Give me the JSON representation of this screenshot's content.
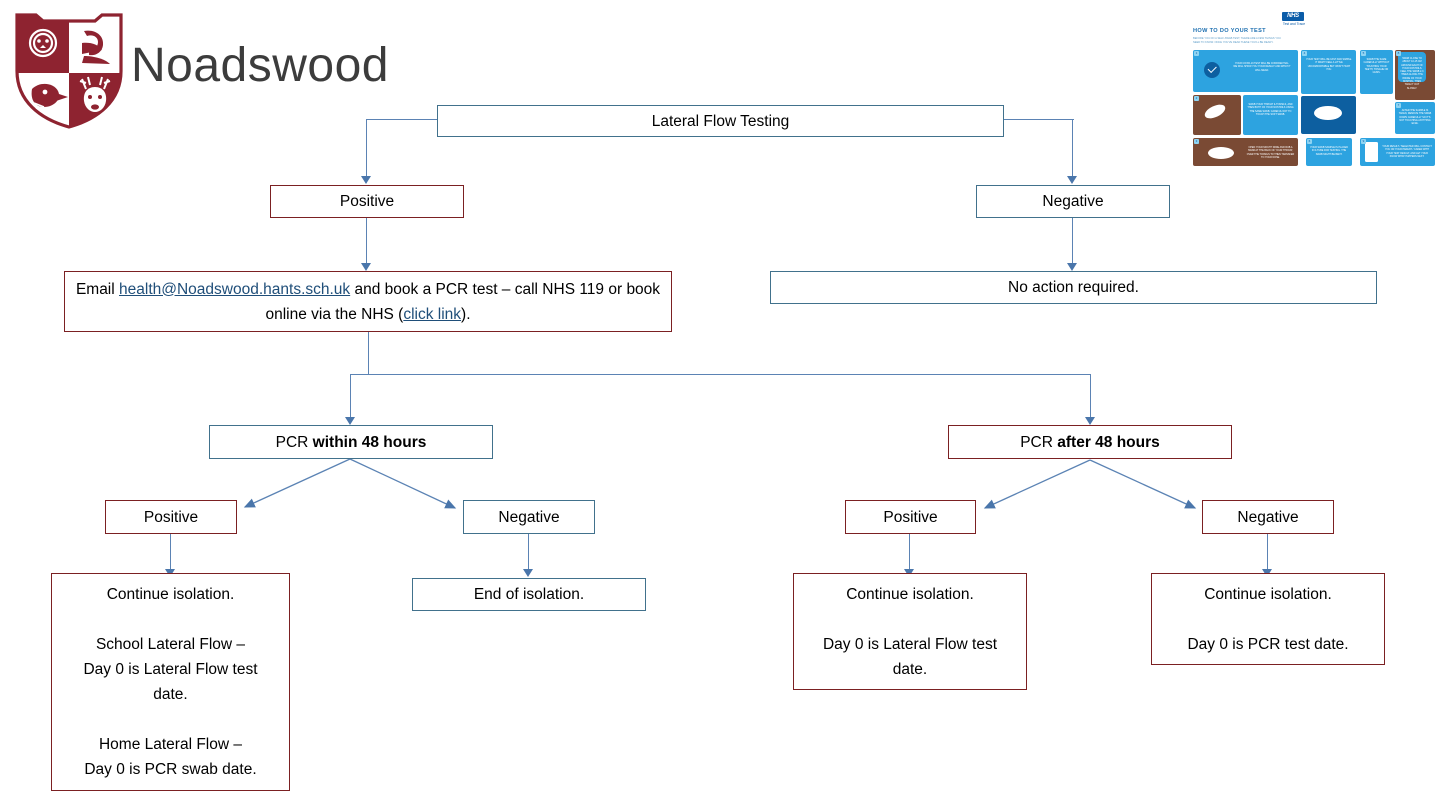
{
  "header": {
    "school_name": "Noadswood",
    "crest_alt": "noadswood-school-crest",
    "crest_color": "#8e2330"
  },
  "poster": {
    "title": "HOW TO DO YOUR TEST",
    "subtitle": "BEFORE YOU DO A SELF-SWAB TEST, THERE ARE A FEW THINGS YOU NEED TO KNOW. ONCE YOU'VE READ THESE YOU'LL BE READY.",
    "logo": "NHS",
    "logo_sub": "Test and Trace",
    "steps": [
      {
        "num": "1",
        "caption": "YOUR COVID-19 TEST WILL BE CONFIDENTIAL. WE WILL SHOW YOU YOUR RESULT AND WHAT IT WILL MEAN."
      },
      {
        "num": "2",
        "caption": "SWAB YOUR THROAT & TONSILS, AND THEN BOTH OF YOUR NOSTRILS USING THE SAME SWAB. CAREFUL NOT TO TOUCH THE SOFT SWAB."
      },
      {
        "num": "3",
        "caption": "OPEN YOUR MOUTH WIDE AND RUB A SWAB AT THE BACK OF YOUR THROAT, OVER THE TONSILS TO THEN TRANSFER TO YOUR NOSE."
      },
      {
        "num": "4",
        "caption": "YOUR TEST WILL BE FAST AND SIMPLE. IT MIGHT FEEL A LITTLE UNCOMFORTABLE BUT WON'T HURT YOU."
      },
      {
        "num": "5",
        "caption": "SWAB THE SAME CAREFULLY WITHOUT TOUCHING YOUR TEETH, TONGUE OR GUMS."
      },
      {
        "num": "6",
        "caption": "YOUR SWAB SAMPLE IS PLACED IN A TUBE FOR TESTING. THE SWAB MIGHT BE BENT."
      },
      {
        "num": "7",
        "caption": "AFTER THE SAMPLE IS TAKEN, REMOVE THE SWAB DOWN CAREFULLY SO IT'S NOT TOUCHING ANYTHING ELSE."
      },
      {
        "num": "8",
        "caption": "SWAB CLOSE TO ABOUT 10-15 CM AROUND EACH OF YOUR NOSTRILS. FEEL THE SWAB 2-3 TIMES ALONG THE INSIDE OF YOUR NOSTRIL, THEN TAKE IT OUT SLOWLY."
      },
      {
        "num": "9",
        "caption": "YOUR RESULT / SELECTED WILL CONTACT YOU OR YOUR PARENT / CARER WITH YOUR TEST RESULT, AND LET YOUR KNOW WHAT HAPPENS NEXT."
      }
    ]
  },
  "flow": {
    "nodes": {
      "lateral_flow_testing": "Lateral Flow Testing",
      "positive_top": "Positive",
      "negative_top": "Negative",
      "email_box": {
        "pre_email": "Email ",
        "email_link": "health@Noadswood.hants.sch.uk",
        "mid": " and book a PCR test – call NHS 119 or book online via the NHS (",
        "click_link": "click link",
        "post": ")."
      },
      "no_action": "No action required.",
      "pcr_within": {
        "plain": "PCR ",
        "bold": "within 48 hours"
      },
      "pcr_after": {
        "plain": "PCR ",
        "bold": "after 48 hours"
      },
      "within_positive": "Positive",
      "within_negative": "Negative",
      "after_positive": "Positive",
      "after_negative": "Negative",
      "within_positive_outcome": {
        "l1": "Continue isolation.",
        "l2": "School Lateral Flow –",
        "l3": "Day 0 is Lateral Flow test",
        "l4": "date.",
        "l5": "Home Lateral Flow –",
        "l6": "Day 0 is PCR swab date."
      },
      "within_negative_outcome": "End of isolation.",
      "after_positive_outcome": {
        "l1": "Continue isolation.",
        "l2": "Day 0 is Lateral Flow test",
        "l3": "date."
      },
      "after_negative_outcome": {
        "l1": "Continue isolation.",
        "l2": "Day 0 is PCR test date."
      }
    },
    "colors": {
      "red_border": "#7b2022",
      "blue_border": "#41718c",
      "connector": "#5b83b4",
      "link": "#1f4e79"
    }
  }
}
